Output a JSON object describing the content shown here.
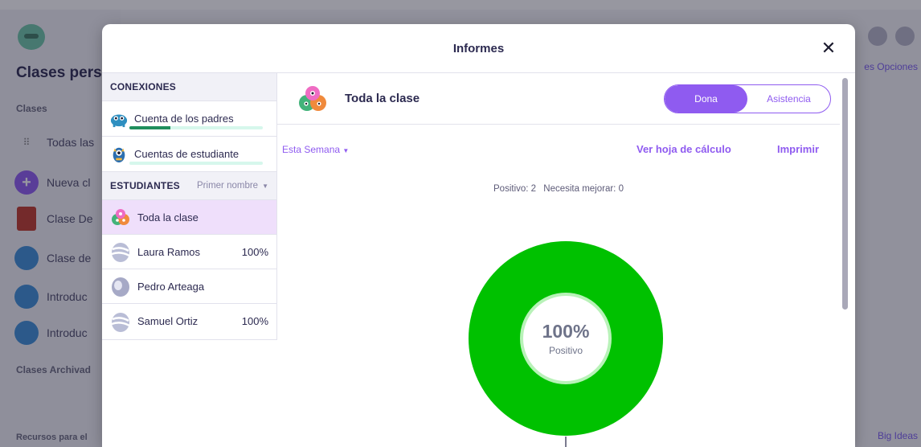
{
  "background": {
    "title": "Clases pers",
    "section_clases": "Clases",
    "rows": [
      "Todas las",
      "Nueva cl",
      "Clase De",
      "Clase de",
      "Introduc",
      "Introduc"
    ],
    "section_archived": "Clases Archivad",
    "footer": "Recursos para el",
    "top_right": "es  Opciones",
    "bottom_right": "Big Ideas"
  },
  "modal": {
    "title": "Informes",
    "close_icon": "close-icon"
  },
  "connections": {
    "header": "CONEXIONES",
    "items": [
      {
        "label": "Cuenta de los padres",
        "icon": "parent-monster-icon",
        "progress": 0.31
      },
      {
        "label": "Cuentas de estudiante",
        "icon": "student-monster-icon",
        "progress": 0
      }
    ]
  },
  "students": {
    "header": "ESTUDIANTES",
    "sort_label": "Primer nombre",
    "items": [
      {
        "name": "Toda la clase",
        "pct": "",
        "avatar": "class-monsters-icon",
        "selected": true
      },
      {
        "name": "Laura Ramos",
        "pct": "100%",
        "avatar": "egg-avatar-icon"
      },
      {
        "name": "Pedro Arteaga",
        "pct": "",
        "avatar": "egg-avatar-icon"
      },
      {
        "name": "Samuel Ortiz",
        "pct": "100%",
        "avatar": "egg-avatar-icon"
      }
    ]
  },
  "main": {
    "class_title": "Toda la clase",
    "toggle": {
      "active": "Dona",
      "inactive": "Asistencia"
    },
    "period": "Esta Semana",
    "spreadsheet_link": "Ver hoja de cálculo",
    "print_link": "Imprimir",
    "summary": {
      "positive": "Positivo: 2",
      "needs_work": "Necesita mejorar: 0"
    }
  },
  "chart_data": {
    "type": "pie",
    "categories": [
      "Positivo",
      "Necesita mejorar"
    ],
    "values": [
      2,
      0
    ],
    "center_value": "100%",
    "center_label": "Positivo",
    "colors": {
      "positive": "#00c100",
      "needs_work": "#e74c3c"
    }
  },
  "colors": {
    "accent": "#8f5bf0",
    "selected_row": "#efdffb",
    "parent_progress": "#1f8e5d"
  }
}
